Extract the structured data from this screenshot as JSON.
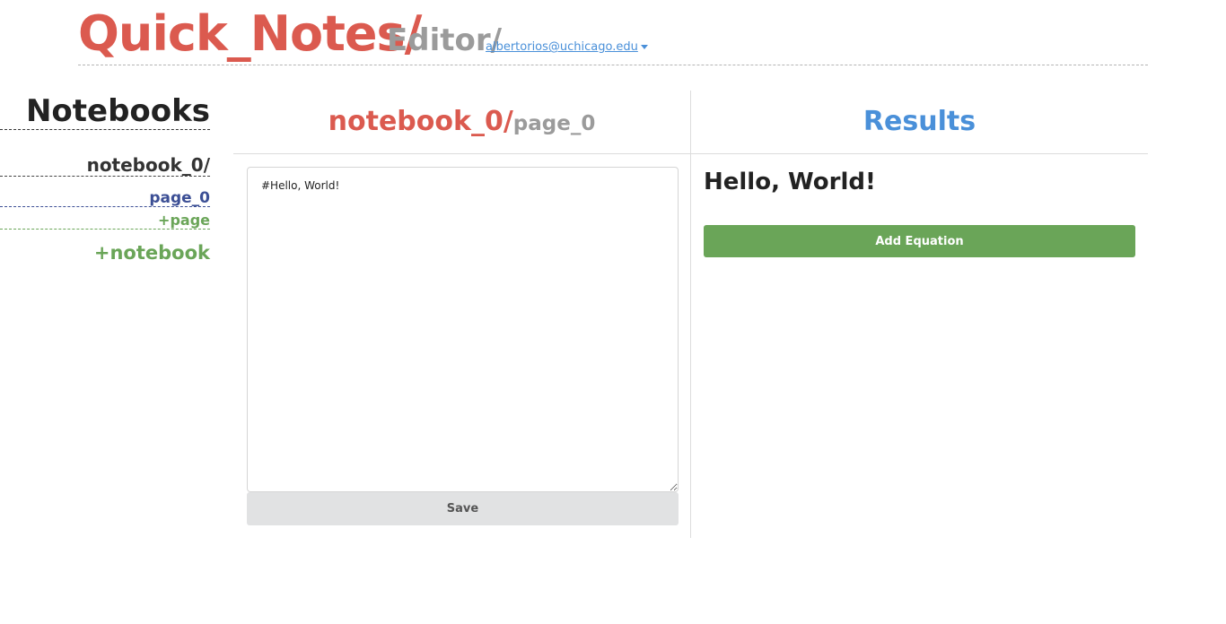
{
  "header": {
    "brand": "Quick_Notes/",
    "section": "Editor/",
    "user_email": "albertorios@uchicago.edu"
  },
  "sidebar": {
    "title": "Notebooks",
    "notebooks": [
      {
        "label": "notebook_0/",
        "pages": [
          {
            "label": "page_0",
            "active": true
          }
        ]
      }
    ],
    "add_page_label": "+page",
    "add_notebook_label": "+notebook"
  },
  "editor": {
    "notebook_crumb": "notebook_0/",
    "page_crumb": "page_0",
    "content": "#Hello, World!",
    "save_label": "Save"
  },
  "results": {
    "title": "Results",
    "rendered_heading": "Hello, World!",
    "add_equation_label": "Add Equation"
  },
  "colors": {
    "brand_red": "#db5a4f",
    "muted_gray": "#9b9b9b",
    "link_blue": "#4a90d9",
    "page_navy": "#3c4f95",
    "action_green": "#6aa558",
    "save_gray": "#e1e2e3"
  },
  "icons": {
    "user_dropdown": "caret-down-icon"
  }
}
